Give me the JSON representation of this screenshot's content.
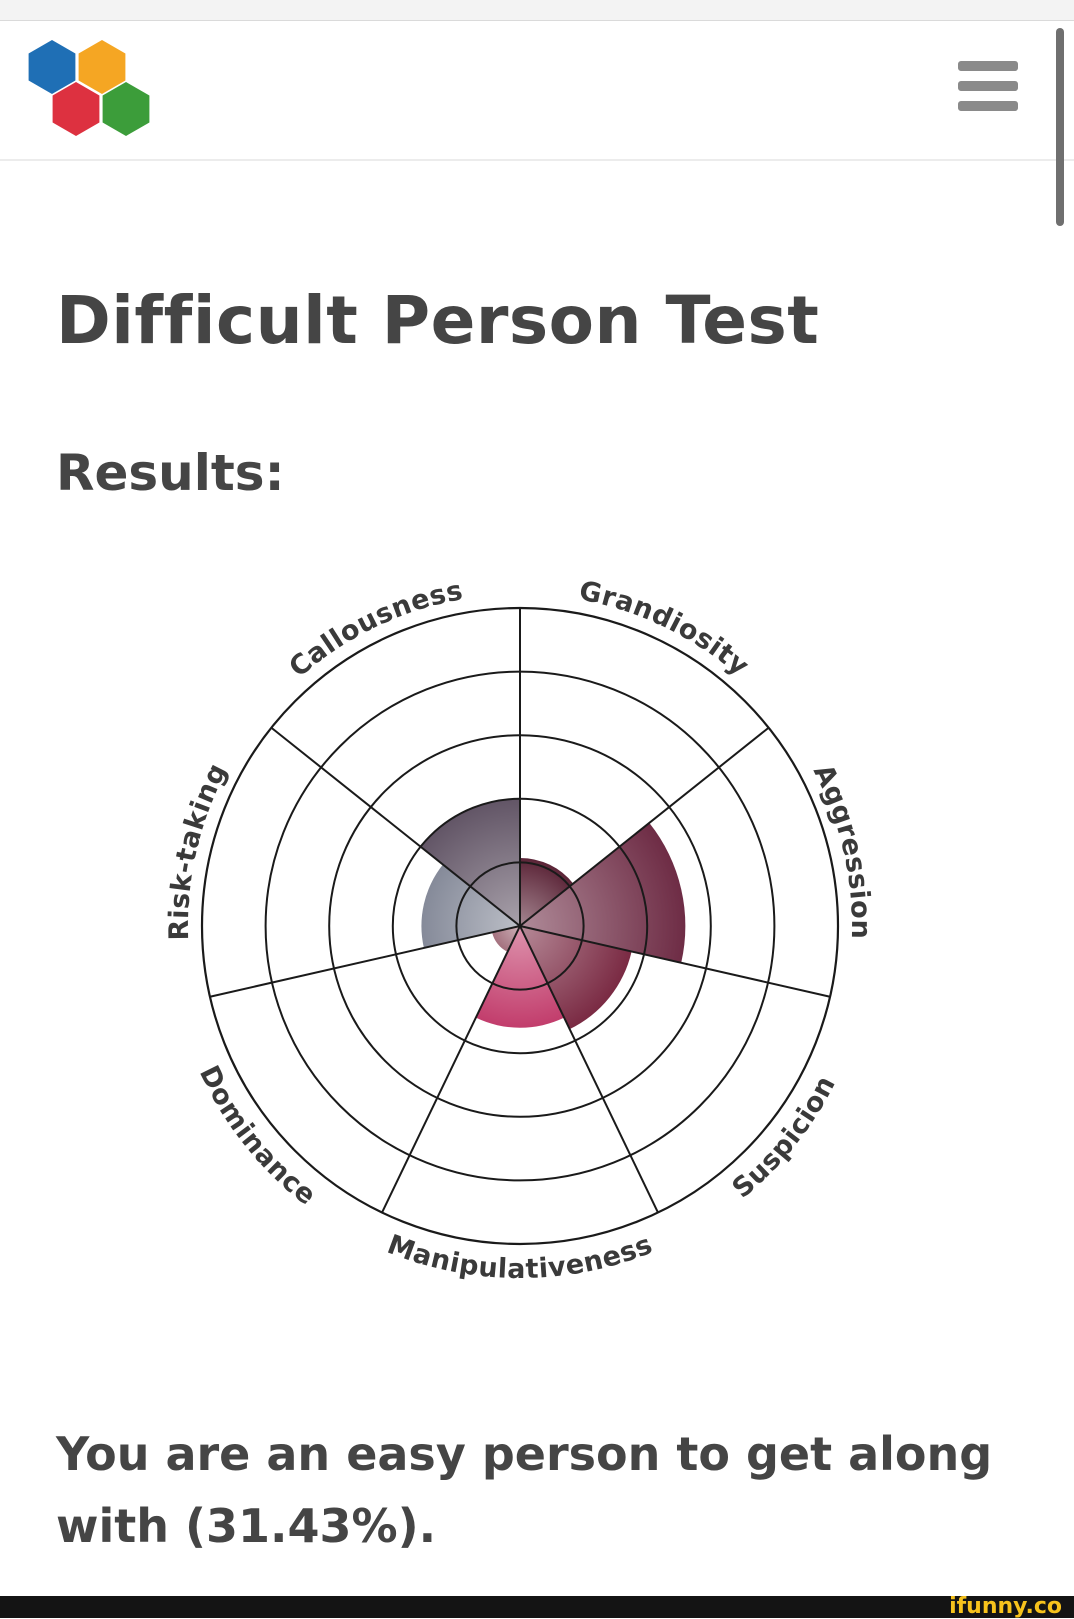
{
  "header": {
    "logo": "colored-hexagons-logo",
    "menu_icon": "hamburger-menu-icon"
  },
  "page": {
    "title": "Difficult Person Test",
    "subtitle": "Results:",
    "result_text": "You are an easy person to get along with (31.43%)."
  },
  "chart_data": {
    "type": "polar-area",
    "scale_rings": 5,
    "scale_max": 5,
    "categories": [
      "Grandiosity",
      "Aggression",
      "Suspicion",
      "Manipulativeness",
      "Dominance",
      "Risk-taking",
      "Callousness"
    ],
    "values": [
      1.07,
      2.6,
      1.8,
      1.6,
      0.45,
      1.55,
      2.0
    ],
    "colors": [
      "#5b2437",
      "#6e2c45",
      "#7a2a43",
      "#c23d6c",
      "#a4717e",
      "#858a99",
      "#625566"
    ]
  },
  "footer": {
    "watermark": "ifunny.co"
  }
}
